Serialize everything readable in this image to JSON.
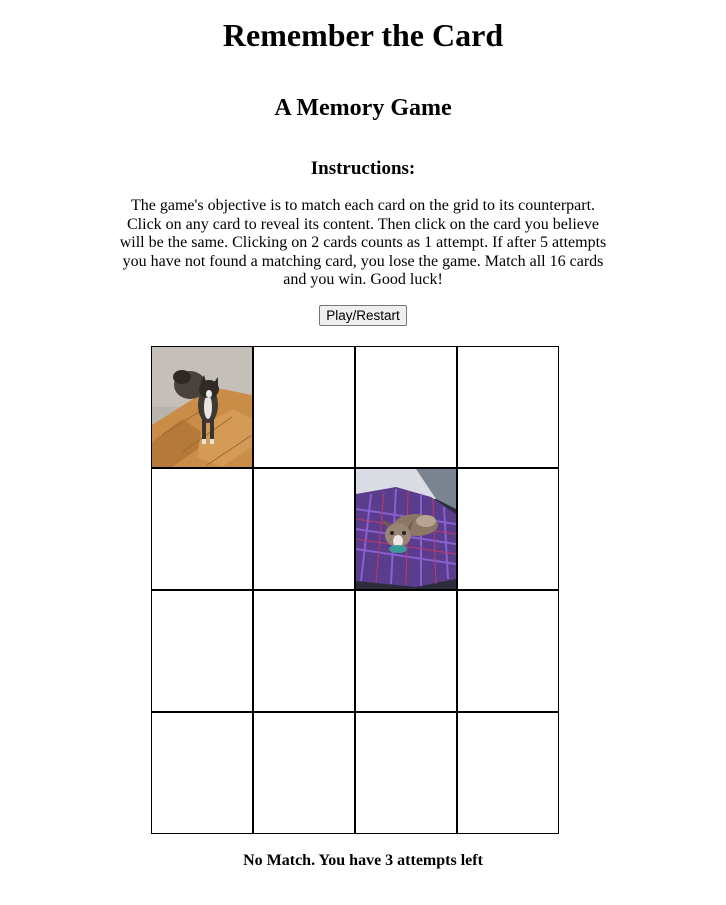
{
  "game": {
    "title": "Remember the Card",
    "subtitle": "A Memory Game",
    "instructions_heading": "Instructions:",
    "instructions_text": "The game's objective is to match each card on the grid to its counterpart. Click on any card to reveal its content. Then click on the card you believe will be the same. Clicking on 2 cards counts as 1 attempt. If after 5 attempts you have not found a matching card, you lose the game. Match all 16 cards and you win. Good luck!",
    "play_button_label": "Play/Restart",
    "status_message": "No Match. You have 3 attempts left"
  },
  "board": {
    "rows": 4,
    "columns": 4,
    "cards": [
      {
        "revealed": true,
        "image": "puppy-on-floor"
      },
      {
        "revealed": false
      },
      {
        "revealed": false
      },
      {
        "revealed": false
      },
      {
        "revealed": false
      },
      {
        "revealed": false
      },
      {
        "revealed": true,
        "image": "puppy-on-blanket"
      },
      {
        "revealed": false
      },
      {
        "revealed": false
      },
      {
        "revealed": false
      },
      {
        "revealed": false
      },
      {
        "revealed": false
      },
      {
        "revealed": false
      },
      {
        "revealed": false
      },
      {
        "revealed": false
      },
      {
        "revealed": false
      }
    ]
  }
}
